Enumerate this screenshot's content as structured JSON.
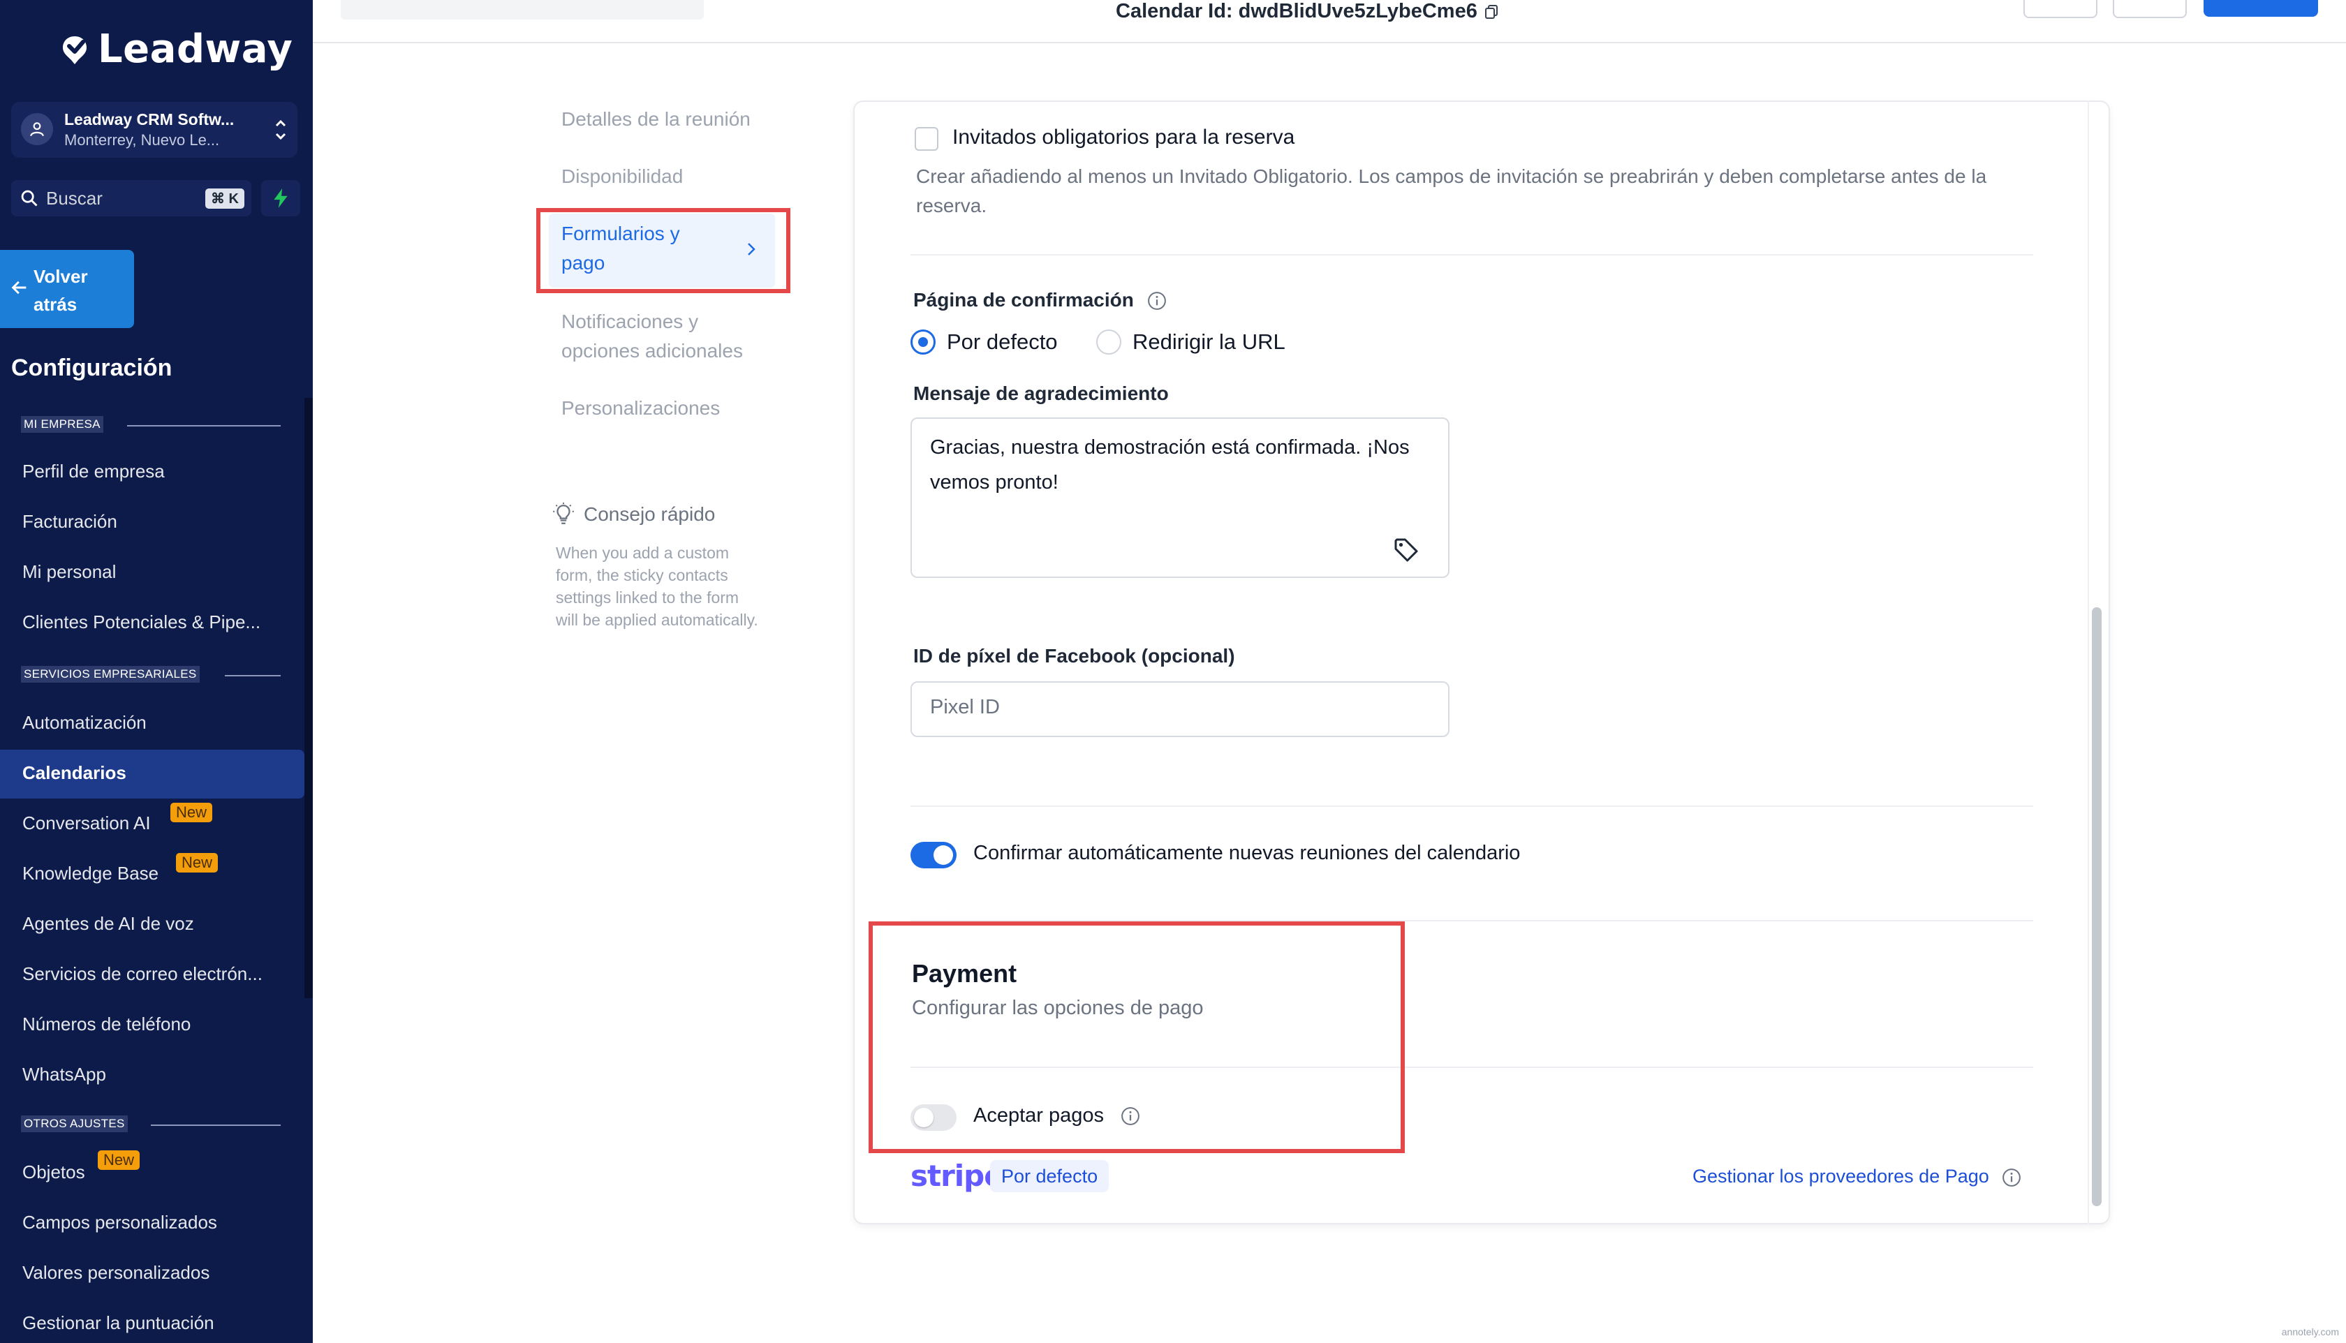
{
  "sidebar": {
    "logo_text": "Leadway",
    "account": {
      "name": "Leadway CRM Softw...",
      "location": "Monterrey, Nuevo Le..."
    },
    "search": {
      "placeholder": "Buscar",
      "shortcut": "⌘ K"
    },
    "back_label": "Volver atrás",
    "config_title": "Configuración",
    "sections": [
      {
        "label": "MI EMPRESA"
      },
      {
        "label": "SERVICIOS EMPRESARIALES"
      },
      {
        "label": "OTROS AJUSTES"
      }
    ],
    "items": [
      {
        "label": "Perfil de empresa"
      },
      {
        "label": "Facturación"
      },
      {
        "label": "Mi personal"
      },
      {
        "label": "Clientes Potenciales & Pipe..."
      },
      {
        "label": "Automatización"
      },
      {
        "label": "Calendarios"
      },
      {
        "label": "Conversation AI",
        "badge": "New"
      },
      {
        "label": "Knowledge Base",
        "badge": "New"
      },
      {
        "label": "Agentes de AI de voz"
      },
      {
        "label": "Servicios de correo electrón..."
      },
      {
        "label": "Números de teléfono"
      },
      {
        "label": "WhatsApp"
      },
      {
        "label": "Objetos",
        "badge": "New"
      },
      {
        "label": "Campos personalizados"
      },
      {
        "label": "Valores personalizados"
      },
      {
        "label": "Gestionar la puntuación"
      }
    ],
    "active_item": "Calendarios"
  },
  "header": {
    "calendar_id": "Calendar Id: dwdBlidUve5zLybeCme6"
  },
  "steps": [
    {
      "label": "Detalles de la reunión"
    },
    {
      "label": "Disponibilidad"
    },
    {
      "label": "Formularios y pago",
      "active": true
    },
    {
      "label": "Notificaciones y opciones adicionales"
    },
    {
      "label": "Personalizaciones"
    }
  ],
  "tip": {
    "title": "Consejo rápido",
    "body": "When you add a custom form, the sticky contacts settings linked to the form will be applied automatically."
  },
  "form": {
    "guests_checkbox_label": "Invitados obligatorios para la reserva",
    "guests_help": "Crear añadiendo al menos un Invitado Obligatorio. Los campos de invitación se preabrirán y deben completarse antes de la reserva.",
    "guests_checked": false,
    "confirmation_label": "Página de confirmación",
    "confirmation_options": [
      "Por defecto",
      "Redirigir la URL"
    ],
    "confirmation_selected": "Por defecto",
    "thanks_label": "Mensaje de agradecimiento",
    "thanks_value": "Gracias, nuestra demostración está confirmada. ¡Nos vemos pronto!",
    "pixel_label": "ID de píxel de Facebook (opcional)",
    "pixel_placeholder": "Pixel ID",
    "pixel_value": "",
    "auto_confirm_label": "Confirmar automáticamente nuevas reuniones del calendario",
    "auto_confirm_on": true
  },
  "payment": {
    "title": "Payment",
    "subtitle": "Configurar las opciones de pago",
    "accept_label": "Aceptar pagos",
    "accept_on": false,
    "provider_logo": "stripe",
    "provider_badge": "Por defecto",
    "manage_link": "Gestionar los proveedores de Pago"
  },
  "watermark": "annotely.com",
  "colors": {
    "sidebar_bg": "#0d1b4b",
    "accent": "#1d6ae5",
    "highlight_red": "#e54848",
    "badge_new": "#f59e0b"
  }
}
